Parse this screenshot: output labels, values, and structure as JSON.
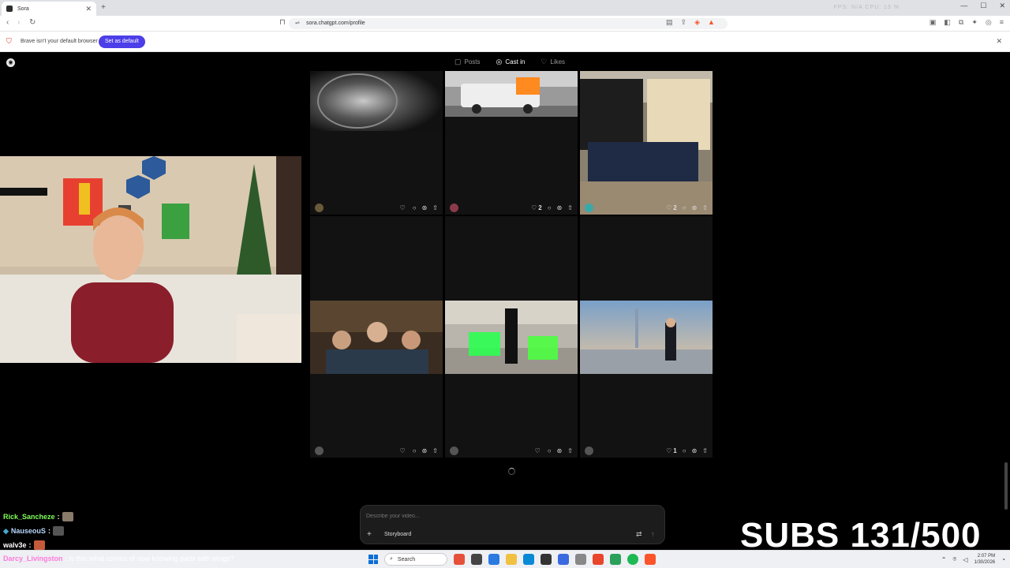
{
  "browser": {
    "tab_title": "Sora",
    "tab_new": "+",
    "url": "sora.chatgpt.com/profile",
    "stats_overlay": "FPS: N/A    CPU: 13 %",
    "infobar_message": "Brave isn't your default browser",
    "infobar_button": "Set as default"
  },
  "profile_tabs": [
    {
      "label": "Posts",
      "icon": "posts-icon",
      "active": false
    },
    {
      "label": "Cast in",
      "icon": "cast-icon",
      "active": true
    },
    {
      "label": "Likes",
      "icon": "heart-icon",
      "active": false
    }
  ],
  "cards": [
    {
      "likes": "",
      "comments": "",
      "remix": ""
    },
    {
      "likes": "2",
      "comments": "",
      "remix": ""
    },
    {
      "likes": "2",
      "comments": "",
      "remix": ""
    },
    {
      "likes": "",
      "comments": "",
      "remix": ""
    },
    {
      "likes": "",
      "comments": "",
      "remix": ""
    },
    {
      "likes": "1",
      "comments": "",
      "remix": ""
    }
  ],
  "composer": {
    "placeholder": "Describe your video...",
    "plus": "+",
    "storyboard": "Storyboard"
  },
  "chat": [
    {
      "user": "Rick_Sancheze",
      "sep": " :",
      "color": "#7fff5a"
    },
    {
      "user": "NauseouS",
      "sep": " :",
      "color": "#b8d8ff"
    },
    {
      "user": "walv3e",
      "sep": " :",
      "color": "#ffffff"
    }
  ],
  "chat_last": {
    "user": "Darcy_Livingston",
    "sep": " :",
    "message": "is this what comes of now knowing pads with wings?",
    "color": "#ff7ad9"
  },
  "subs": "SUBS 131/500",
  "taskbar": {
    "search": "Search",
    "time": "2:07 PM",
    "date": "1/30/2026"
  }
}
